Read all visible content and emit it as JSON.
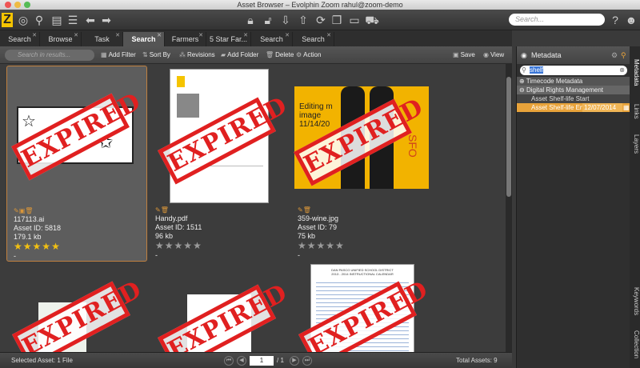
{
  "window": {
    "title": "Asset Browser – Evolphin Zoom rahul@zoom-demo"
  },
  "toolbar": {
    "search_placeholder": "Search..."
  },
  "tabs": [
    {
      "label": "Search"
    },
    {
      "label": "Browse"
    },
    {
      "label": "Task"
    },
    {
      "label": "Search"
    },
    {
      "label": "Farmers"
    },
    {
      "label": "5 Star Far..."
    },
    {
      "label": "Search"
    },
    {
      "label": "Search"
    }
  ],
  "actions": {
    "search_placeholder": "Search in results...",
    "add_filter": "Add Filter",
    "sort_by": "Sort By",
    "revisions": "Revisions",
    "add_folder": "Add Folder",
    "delete": "Delete",
    "action": "Action",
    "save": "Save",
    "view": "View"
  },
  "assets": [
    {
      "name": "117113.ai",
      "asset_id": "Asset ID: 5818",
      "size": "179.1 kb",
      "rating": 5,
      "dash": "-",
      "stamp": "EXPIRED"
    },
    {
      "name": "Handy.pdf",
      "asset_id": "Asset ID: 1511",
      "size": "96 kb",
      "rating": 0,
      "dash": "-",
      "stamp": "EXPIRED"
    },
    {
      "name": "359-wine.jpg",
      "asset_id": "Asset ID: 79",
      "size": "75 kb",
      "rating": 0,
      "dash": "-",
      "stamp": "EXPIRED"
    }
  ],
  "assets_row2": [
    {
      "stamp": "EXPIRED"
    },
    {
      "stamp": "EXPIRED"
    },
    {
      "stamp": "EXPIRED"
    }
  ],
  "thumb_text": {
    "wine_caption": "Editing m\nimage\n11/14/20",
    "sfo": "SFO",
    "doc_title": "DAN PASCO UNIFIED SCHOOL DISTRICT\n2013 - 2014 INSTRUCTIONAL CALENDAR"
  },
  "status": {
    "selected": "Selected Asset: 1 File",
    "page_current": "1",
    "page_total": "/ 1",
    "total_assets": "Total Assets: 9"
  },
  "metadata": {
    "header": "Metadata",
    "search_value": "shelf",
    "sections": [
      {
        "label": "Timecode Metadata"
      },
      {
        "label": "Digital Rights Management"
      }
    ],
    "fields": [
      {
        "label": "Asset Shelf-life Start",
        "value": ""
      },
      {
        "label": "Asset Shelf-life End",
        "value": "12/07/2014"
      }
    ]
  },
  "side_tabs": [
    "Metadata",
    "Links",
    "Layers",
    "Keywords",
    "Collection"
  ],
  "colors": {
    "accent": "#e8a33a",
    "stamp": "#e02020",
    "star_on": "#f2c012",
    "star_off": "#9a9a9a"
  }
}
